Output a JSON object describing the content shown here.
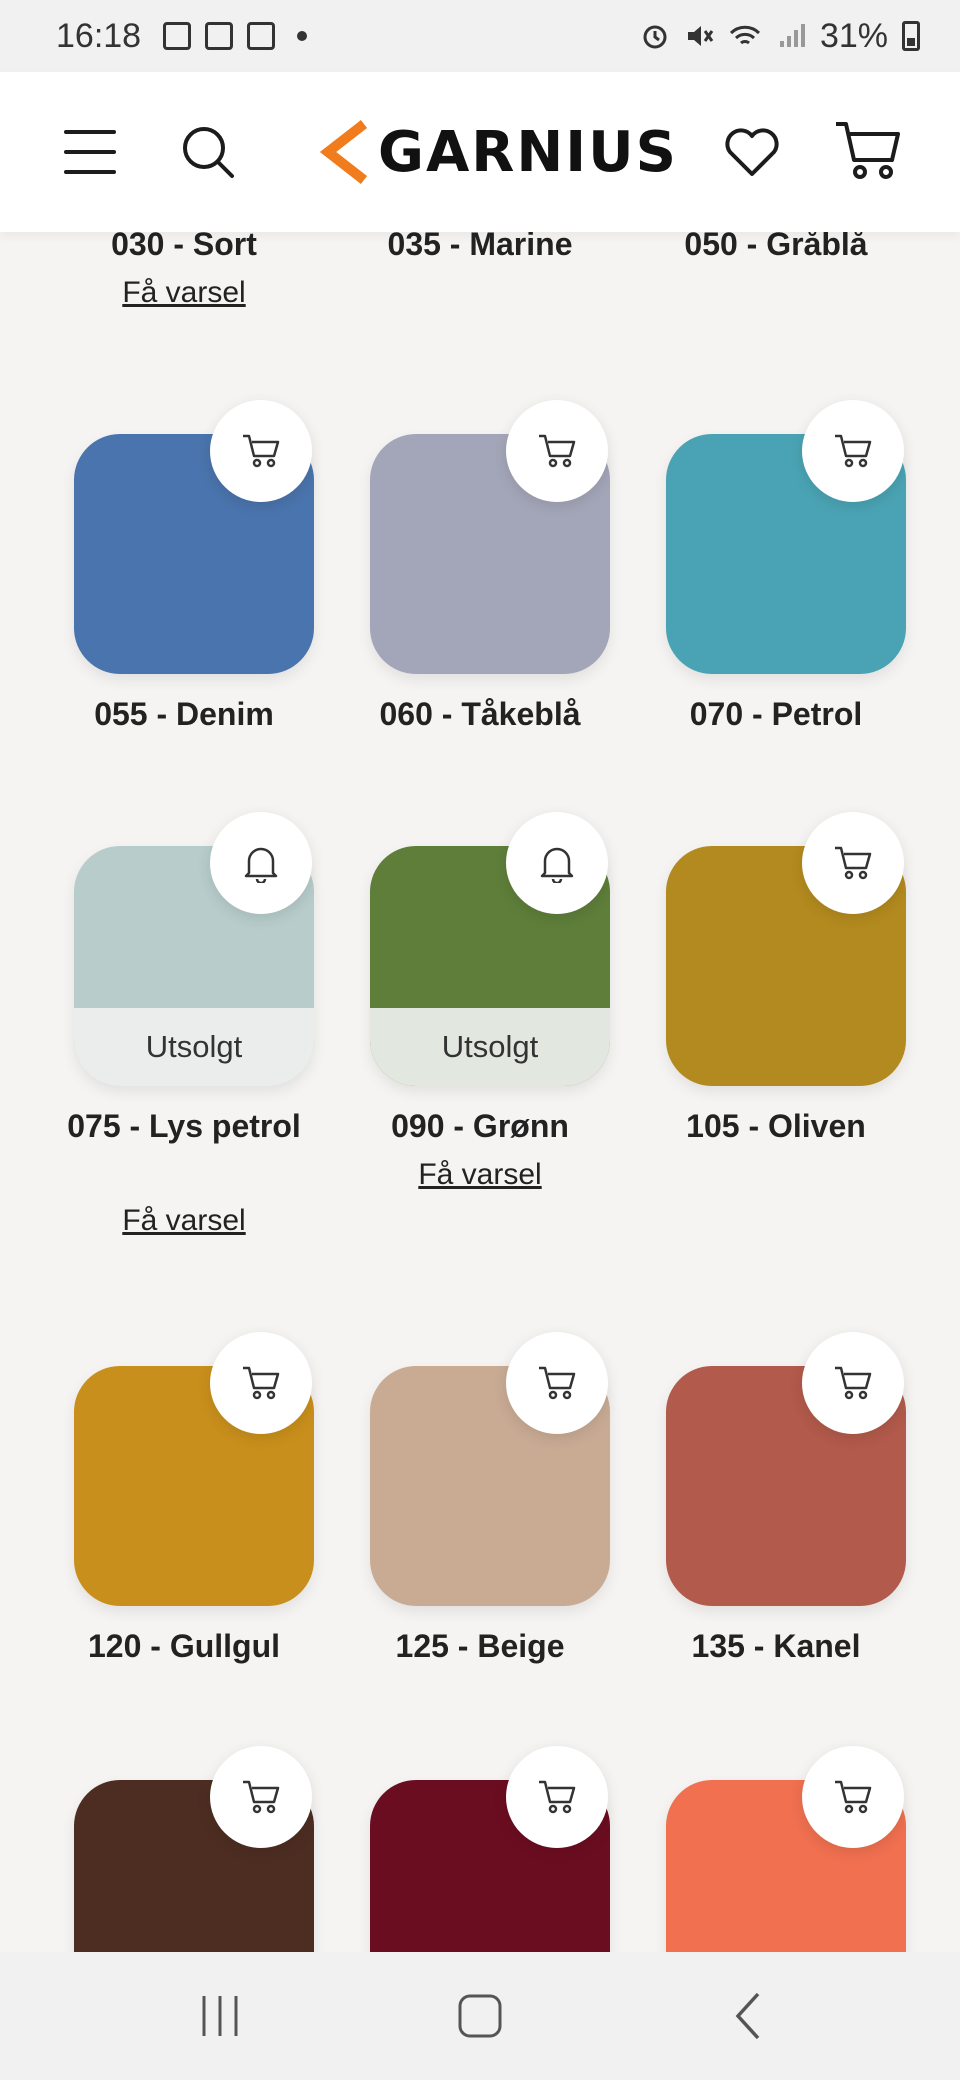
{
  "status": {
    "time": "16:18",
    "battery": "31%"
  },
  "header": {
    "brand": "GARNIUS",
    "brand_color": "#f07c1e"
  },
  "products": [
    {
      "name": "030 - Sort",
      "notify": "Få varsel",
      "color": "#2b2b2b"
    },
    {
      "name": "035 - Marine",
      "notify": "",
      "color": "#263a5e"
    },
    {
      "name": "050 - Gråblå",
      "notify": "",
      "color": "#7a8aa0"
    },
    {
      "name": "055 - Denim",
      "notify": "",
      "color": "#4a74ad",
      "action": "cart-icon"
    },
    {
      "name": "060 - Tåkeblå",
      "notify": "",
      "color": "#a3a6b8",
      "action": "cart-icon"
    },
    {
      "name": "070 - Petrol",
      "notify": "",
      "color": "#4aa3b4",
      "action": "cart-icon"
    },
    {
      "name": "075 - Lys petrol",
      "notify": "Få varsel",
      "color": "#b7cccb",
      "action": "bell-icon",
      "sold_out": "Utsolgt"
    },
    {
      "name": "090 - Grønn",
      "notify": "Få varsel",
      "color": "#5e7e3a",
      "action": "bell-icon",
      "sold_out": "Utsolgt"
    },
    {
      "name": "105 - Oliven",
      "notify": "",
      "color": "#b38a1f",
      "action": "cart-icon"
    },
    {
      "name": "120 - Gullgul",
      "notify": "",
      "color": "#c98f1c",
      "action": "cart-icon"
    },
    {
      "name": "125 - Beige",
      "notify": "",
      "color": "#c9ab94",
      "action": "cart-icon"
    },
    {
      "name": "135 - Kanel",
      "notify": "",
      "color": "#b25a4b",
      "action": "cart-icon"
    },
    {
      "name": "",
      "notify": "",
      "color": "#4d2d22",
      "action": "cart-icon"
    },
    {
      "name": "",
      "notify": "",
      "color": "#6b0d20",
      "action": "cart-icon"
    },
    {
      "name": "",
      "notify": "",
      "color": "#f07050",
      "action": "cart-icon"
    }
  ]
}
